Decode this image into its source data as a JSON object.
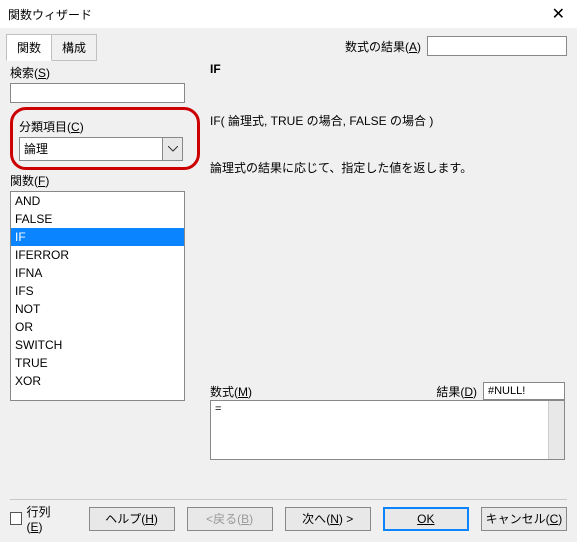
{
  "title": "関数ウィザード",
  "tabs": [
    "関数",
    "構成"
  ],
  "labels": {
    "result_formula": "数式の結果",
    "search": "検索",
    "category": "分類項目",
    "function": "関数",
    "formula": "数式",
    "result": "結果",
    "matrix": "行列"
  },
  "accel": {
    "result_formula": "A",
    "search": "S",
    "category": "C",
    "function": "F",
    "formula": "M",
    "result": "D",
    "matrix": "E",
    "help": "H",
    "back": "B",
    "next": "N",
    "cancel": "C"
  },
  "category": {
    "selected": "論理"
  },
  "functions": {
    "items": [
      "AND",
      "FALSE",
      "IF",
      "IFERROR",
      "IFNA",
      "IFS",
      "NOT",
      "OR",
      "SWITCH",
      "TRUE",
      "XOR"
    ],
    "selected": "IF"
  },
  "detail": {
    "name": "IF",
    "signature": "IF( 論理式, TRUE の場合, FALSE の場合 )",
    "description": "論理式の結果に応じて、指定した値を返します。"
  },
  "formula_value": "=",
  "result_value": "#NULL!",
  "buttons": {
    "help": "ヘルプ",
    "back": "戻る",
    "next": "次へ",
    "ok": "OK",
    "cancel": "キャンセル"
  }
}
